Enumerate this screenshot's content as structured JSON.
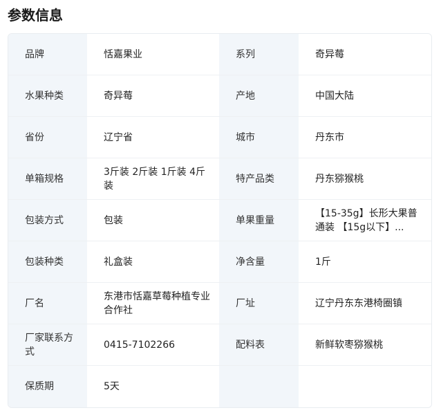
{
  "section": {
    "title": "参数信息"
  },
  "params": {
    "rows": [
      {
        "l1": "品牌",
        "v1": "恬嘉果业",
        "l2": "系列",
        "v2": "奇异莓"
      },
      {
        "l1": "水果种类",
        "v1": "奇异莓",
        "l2": "产地",
        "v2": "中国大陆"
      },
      {
        "l1": "省份",
        "v1": "辽宁省",
        "l2": "城市",
        "v2": "丹东市"
      },
      {
        "l1": "单箱规格",
        "v1": "3斤装 2斤装 1斤装 4斤装",
        "l2": "特产品类",
        "v2": "丹东猕猴桃"
      },
      {
        "l1": "包装方式",
        "v1": "包装",
        "l2": "单果重量",
        "v2": "【15-35g】长形大果普通装 【15g以下】..."
      },
      {
        "l1": "包装种类",
        "v1": "礼盒装",
        "l2": "净含量",
        "v2": "1斤"
      },
      {
        "l1": "厂名",
        "v1": "东港市恬嘉草莓种植专业 合作社",
        "l2": "厂址",
        "v2": "辽宁丹东东港椅圈镇"
      },
      {
        "l1": "厂家联系方式",
        "v1": "0415-7102266",
        "l2": "配料表",
        "v2": "新鲜软枣猕猴桃"
      },
      {
        "l1": "保质期",
        "v1": "5天",
        "l2": "",
        "v2": ""
      }
    ]
  }
}
